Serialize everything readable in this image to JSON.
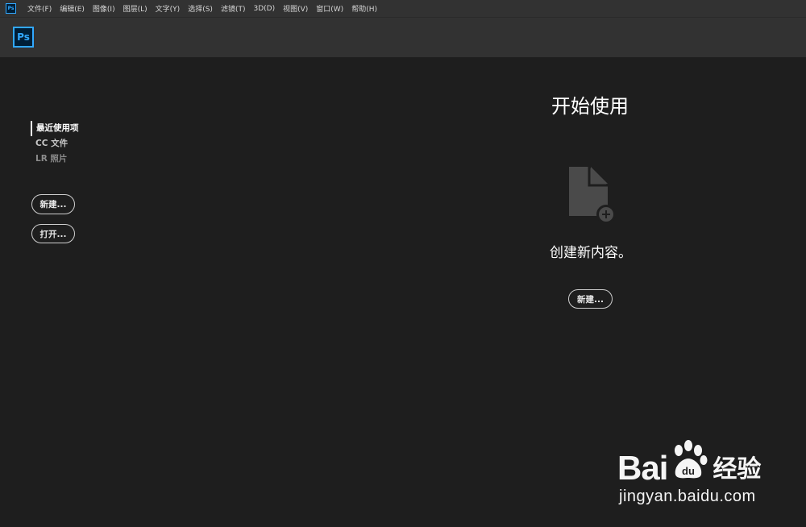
{
  "app": {
    "icon_name": "ps-app-icon",
    "icon_text": "Ps",
    "accent": "#31a8ff"
  },
  "menubar": {
    "items": [
      "文件(F)",
      "编辑(E)",
      "图像(I)",
      "图层(L)",
      "文字(Y)",
      "选择(S)",
      "滤镜(T)",
      "3D(D)",
      "视图(V)",
      "窗口(W)",
      "帮助(H)"
    ]
  },
  "header": {
    "logo_text": "Ps"
  },
  "sidebar": {
    "items": [
      {
        "label": "最近使用项",
        "active": true
      },
      {
        "label": "CC 文件",
        "active": false
      },
      {
        "label": "LR 照片",
        "active": false
      }
    ],
    "new_button": "新建...",
    "open_button": "打开..."
  },
  "main": {
    "title": "开始使用",
    "icon_name": "new-document-icon",
    "subtitle": "创建新内容。",
    "new_button": "新建..."
  },
  "watermark": {
    "brand": "Bai",
    "brand_icon": "paw-icon",
    "brand_suffix": "经验",
    "url": "jingyan.baidu.com"
  }
}
